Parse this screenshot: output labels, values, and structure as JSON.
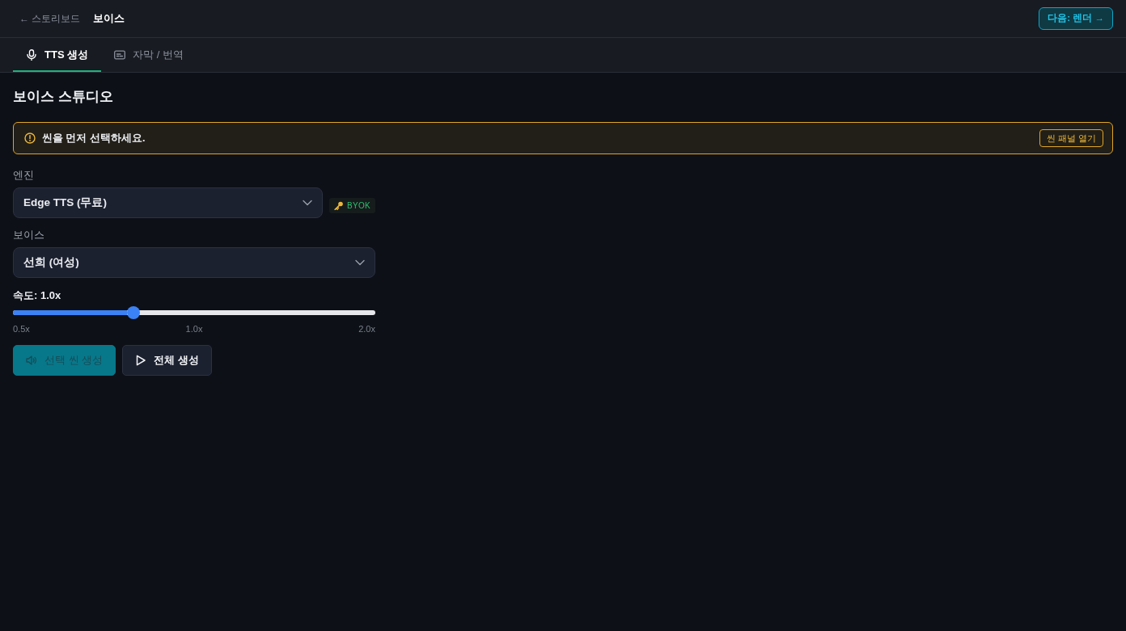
{
  "header": {
    "back_link": "← 스토리보드",
    "title": "보이스",
    "next_button": "다음: 렌더 →"
  },
  "tabs": [
    {
      "label": "TTS 생성",
      "kind": "mic",
      "selected": true
    },
    {
      "label": "자막 / 번역",
      "kind": "subtitles",
      "selected": false
    }
  ],
  "page_title": "보이스 스튜디오",
  "alert": {
    "message": "씬을 먼저 선택하세요.",
    "action": "씬 패널 열기"
  },
  "engine": {
    "label": "엔진",
    "value": "Edge TTS (무료)",
    "badge": "BYOK"
  },
  "voice": {
    "label": "보이스",
    "value": "선희 (여성)"
  },
  "speed": {
    "label": "속도: 1.0x",
    "level": 0.333,
    "ticks": [
      "0.5x",
      "1.0x",
      "2.0x"
    ]
  },
  "actions": [
    {
      "label": "선택 씬 생성",
      "kind": "speaker",
      "disabled": true
    },
    {
      "label": "전체 생성",
      "kind": "play",
      "disabled": false
    }
  ]
}
